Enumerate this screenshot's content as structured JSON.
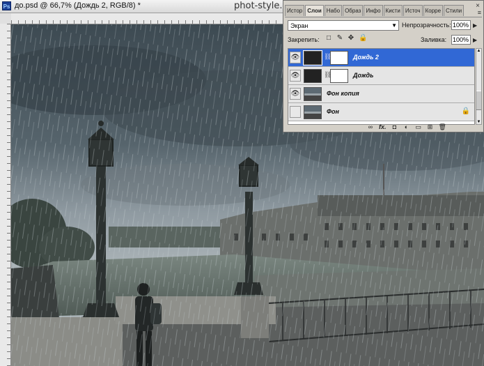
{
  "document": {
    "title": "до.psd @ 66,7% (Дождь 2, RGB/8) *",
    "app_icon": "Ps"
  },
  "watermark": "phot-style.ru",
  "layers_panel": {
    "tabs": [
      "Истор",
      "Слои",
      "Набо",
      "Образ",
      "Инфо",
      "Кисти",
      "Источ",
      "Корре",
      "Стили"
    ],
    "active_tab": "Слои",
    "close_glyph": "×",
    "menu_glyph": "≡",
    "blend_mode": "Экран",
    "opacity_label": "Непрозрачность:",
    "opacity_value": "100%",
    "lock_label": "Закрепить:",
    "fill_label": "Заливка:",
    "fill_value": "100%",
    "layers": [
      {
        "name": "Дождь 2",
        "visible": true,
        "selected": true,
        "has_mask": true,
        "thumb": "dark"
      },
      {
        "name": "Дождь",
        "visible": true,
        "selected": false,
        "has_mask": true,
        "thumb": "dark"
      },
      {
        "name": "Фон копия",
        "visible": true,
        "selected": false,
        "has_mask": false,
        "thumb": "photo"
      },
      {
        "name": "Фон",
        "visible": false,
        "selected": false,
        "has_mask": false,
        "thumb": "photo",
        "locked": true
      }
    ],
    "bottom_icons": [
      "link-icon",
      "fx-icon",
      "mask-icon",
      "adjustment-icon",
      "group-icon",
      "new-layer-icon",
      "trash-icon"
    ],
    "bottom_labels": {
      "link": "∞",
      "fx": "fx.",
      "mask": "◘",
      "adjust": "◐",
      "group": "▭",
      "new": "⊞",
      "trash": "🗑"
    }
  }
}
